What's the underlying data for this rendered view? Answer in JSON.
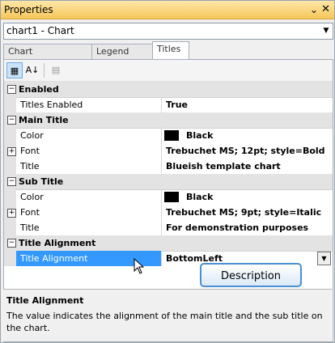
{
  "window": {
    "title": "Properties"
  },
  "object_selector": {
    "value": "chart1 - Chart"
  },
  "tabs": [
    {
      "label": "Chart Background",
      "active": false
    },
    {
      "label": "Legend Area",
      "active": false
    },
    {
      "label": "Titles",
      "active": true
    }
  ],
  "toolbar": {
    "categorized_icon": "categorized-icon",
    "alphabetical_icon": "alphabetical-icon",
    "property_pages_icon": "property-pages-icon"
  },
  "grid": {
    "categories": [
      {
        "label": "Enabled",
        "props": [
          {
            "name": "Titles Enabled",
            "value": "True"
          }
        ]
      },
      {
        "label": "Main Title",
        "props": [
          {
            "name": "Color",
            "value": "Black",
            "swatch": "#000000"
          },
          {
            "name": "Font",
            "value": "Trebuchet MS; 12pt; style=Bold",
            "expandable": true
          },
          {
            "name": "Title",
            "value": "Blueish template chart"
          }
        ]
      },
      {
        "label": "Sub Title",
        "props": [
          {
            "name": "Color",
            "value": "Black",
            "swatch": "#000000"
          },
          {
            "name": "Font",
            "value": "Trebuchet MS; 9pt; style=Italic",
            "expandable": true
          },
          {
            "name": "Title",
            "value": "For demonstration purposes"
          }
        ]
      },
      {
        "label": "Title Alignment",
        "props": [
          {
            "name": "Title Alignment",
            "value": "BottomLeft",
            "selected": true
          }
        ]
      }
    ]
  },
  "callout": {
    "label": "Description"
  },
  "description": {
    "title": "Title Alignment",
    "text": "The value indicates the alignment of the main title and the sub title on the chart."
  },
  "colors": {
    "selection": "#3399ff",
    "titlebar": "#f6c75b",
    "category_bg": "#e3e3e3"
  }
}
